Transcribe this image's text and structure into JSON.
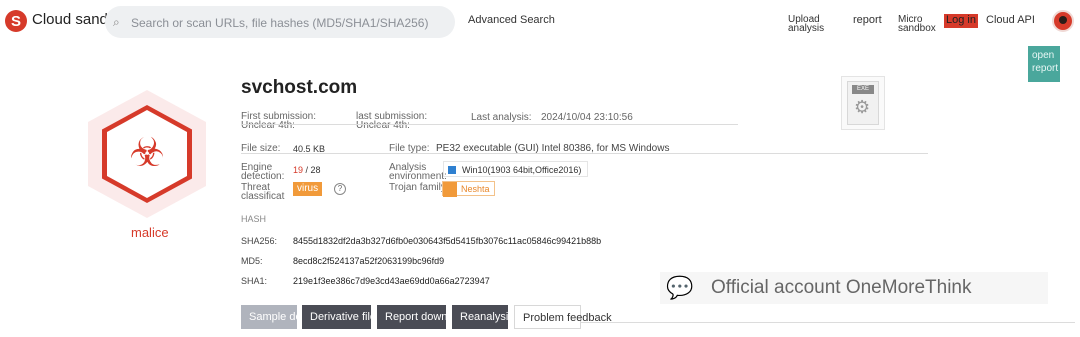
{
  "header": {
    "logo_letter": "S",
    "app_name": "Cloud sandbox",
    "search_placeholder": "Search or scan URLs, file hashes (MD5/SHA1/SHA256)",
    "nav_advanced": "Advanced Search",
    "nav_upload_1": "Upload",
    "nav_upload_2": "analysis",
    "nav_report": "report",
    "nav_micro_1": "Micro",
    "nav_micro_2": "sandbox",
    "nav_login": "Log in",
    "nav_cloud_api": "Cloud API"
  },
  "side_tab": {
    "line1": "open",
    "line2": "report"
  },
  "verdict": {
    "label": "malice",
    "icon": "biohazard-icon",
    "color": "#d63a2a"
  },
  "file": {
    "name": "svchost.com",
    "first_submission_label": "First submission:",
    "first_submission_sub": "Unclear 4th:",
    "last_submission_label": "last submission:",
    "last_submission_sub": "Unclear 4th:",
    "last_analysis_label": "Last analysis:",
    "last_analysis_value": "2024/10/04 23:10:56",
    "size_label": "File size:",
    "size_value": "40.5 KB",
    "type_label": "File type:",
    "type_value": "PE32 executable (GUI) Intel 80386, for MS Windows",
    "engine_label_1": "Engine",
    "engine_label_2": "detection:",
    "engine_detected": "19",
    "engine_total": "/ 28",
    "env_label_1": "Analysis",
    "env_label_2": "environment:",
    "env_value": "Win10(1903 64bit,Office2016)",
    "threat_label_1": "Threat",
    "threat_label_2": "classificat",
    "threat_value": "virus",
    "family_label": "Trojan family:",
    "family_value": "Neshta"
  },
  "hash": {
    "title": "HASH",
    "sha256_label": "SHA256:",
    "sha256": "8455d1832df2da3b327d6fb0e030643f5d5415fb3076c11ac05846c99421b88b",
    "md5_label": "MD5:",
    "md5": "8ecd8c2f524137a52f2063199bc96fd9",
    "sha1_label": "SHA1:",
    "sha1": "219e1f3ee386c7d9e3cd43ae69dd0a66a2723947"
  },
  "exe_badge": "EXE",
  "actions": {
    "sample_1": "Sample",
    "sample_2": "download",
    "derivative_1": "Derivative",
    "derivative_2": "files",
    "report_1": "Report",
    "report_2": "download",
    "reanalyze": "Reanalysis",
    "feedback": "Problem feedback"
  },
  "watermark": {
    "text": "Official account OneMoreThink",
    "icon": "wechat-icon"
  }
}
